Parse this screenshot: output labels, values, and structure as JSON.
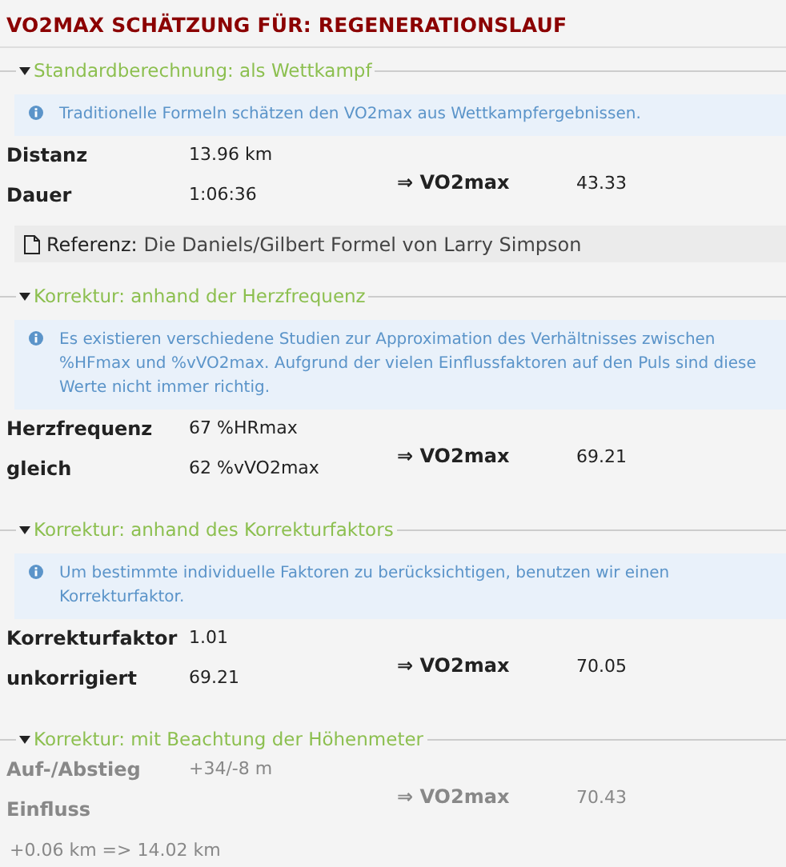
{
  "title": "VO2MAX SCHÄTZUNG FÜR: REGENERATIONSLAUF",
  "sections": [
    {
      "legend": "Standardberechnung: als Wettkampf",
      "expanded": true,
      "disabled": false,
      "info": "Traditionelle Formeln schätzen den VO2max aus Wettkampfergebnissen.",
      "rows": [
        {
          "label": "Distanz",
          "value": "13.96 km"
        },
        {
          "label": "Dauer",
          "value": "1:06:36"
        }
      ],
      "result_label": "⇒ VO2max",
      "result_value": "43.33",
      "reference": {
        "label": "Referenz:",
        "text": "Die Daniels/Gilbert Formel von Larry Simpson"
      }
    },
    {
      "legend": "Korrektur: anhand der Herzfrequenz",
      "expanded": true,
      "disabled": false,
      "info": "Es existieren verschiedene Studien zur Approximation des Verhältnisses zwischen %HFmax und %vVO2max. Aufgrund der vielen Einflussfaktoren auf den Puls sind diese Werte nicht immer richtig.",
      "rows": [
        {
          "label": "Herzfrequenz",
          "value": "67 %HRmax"
        },
        {
          "label": "gleich",
          "value": "62 %vVO2max"
        }
      ],
      "result_label": "⇒ VO2max",
      "result_value": "69.21"
    },
    {
      "legend": "Korrektur: anhand des Korrekturfaktors",
      "expanded": true,
      "disabled": false,
      "info": "Um bestimmte individuelle Faktoren zu berücksichtigen, benutzen wir einen Korrekturfaktor.",
      "rows": [
        {
          "label": "Korrekturfaktor",
          "value": "1.01"
        },
        {
          "label": "unkorrigiert",
          "value": "69.21"
        }
      ],
      "result_label": "⇒ VO2max",
      "result_value": "70.05"
    },
    {
      "legend": "Korrektur: mit Beachtung der Höhenmeter",
      "expanded": true,
      "disabled": true,
      "rows": [
        {
          "label": "Auf-/Abstieg",
          "value": "+34/-8 m"
        },
        {
          "label": "Einfluss"
        }
      ],
      "result_label": "⇒ VO2max",
      "result_value": "70.43",
      "note": "+0.06 km => 14.02 km"
    }
  ]
}
